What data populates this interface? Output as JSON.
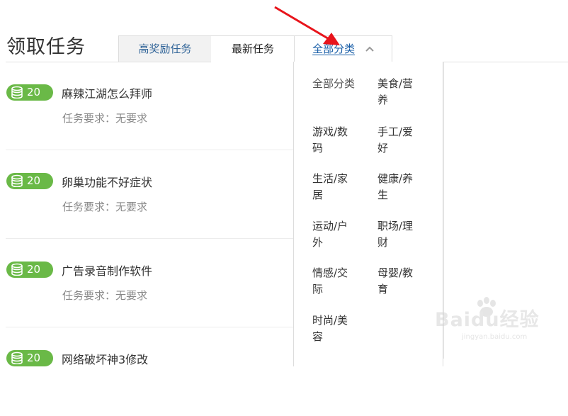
{
  "header": {
    "title": "领取任务"
  },
  "tabs": [
    {
      "label": "高奖励任务"
    },
    {
      "label": "最新任务"
    },
    {
      "label": "全部分类"
    }
  ],
  "tasks": [
    {
      "coins": "20",
      "title": "麻辣江湖怎么拜师",
      "requirement": "任务要求：无要求"
    },
    {
      "coins": "20",
      "title": "卵巢功能不好症状",
      "requirement": "任务要求：无要求"
    },
    {
      "coins": "20",
      "title": "广告录音制作软件",
      "requirement": "任务要求：无要求"
    },
    {
      "coins": "20",
      "title": "网络破坏神3修改",
      "requirement": ""
    }
  ],
  "categories": {
    "all": "全部分类",
    "left": [
      [
        "游戏/数",
        "码"
      ],
      [
        "生活/家",
        "居"
      ],
      [
        "运动/户",
        "外"
      ],
      [
        "情感/交",
        "际"
      ],
      [
        "时尚/美",
        "容"
      ]
    ],
    "right": [
      [
        "美食/营",
        "养"
      ],
      [
        "手工/爱",
        "好"
      ],
      [
        "健康/养",
        "生"
      ],
      [
        "职场/理",
        "财"
      ],
      [
        "母婴/教",
        "育"
      ]
    ]
  },
  "watermark": {
    "text": "Baidu经验",
    "url": "jingyan.baidu.com"
  },
  "colors": {
    "coin_badge": "#6ab947",
    "link": "#1a5fa8",
    "annotation_arrow": "#e8141b"
  },
  "icons": {
    "coin": "coin-stack-icon",
    "chevron": "chevron-up-icon",
    "arrow": "red-arrow-icon"
  }
}
